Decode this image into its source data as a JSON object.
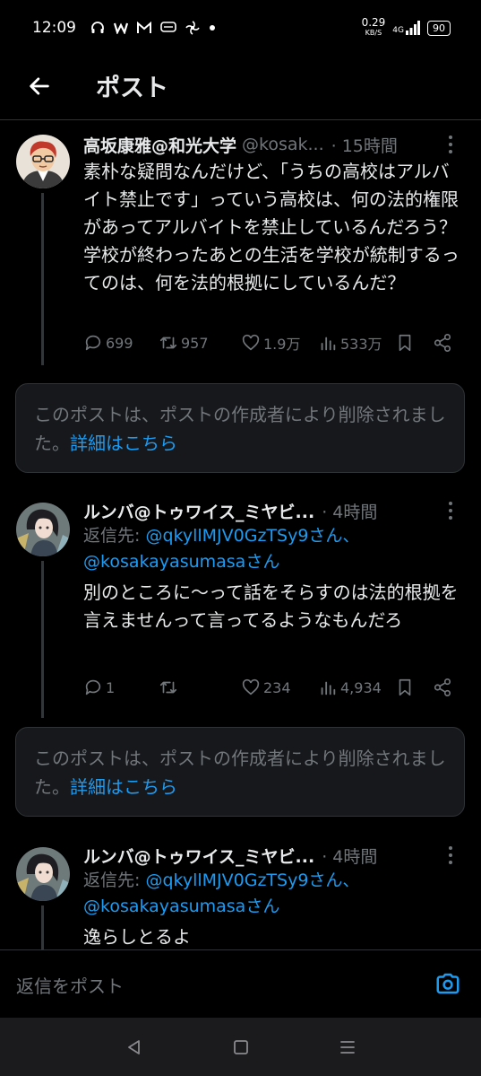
{
  "status": {
    "time": "12:09",
    "speed_value": "0.29",
    "speed_unit": "KB/S",
    "network": "4G",
    "battery": "90",
    "icons": [
      "headphones-icon",
      "w-app-icon",
      "gmail-icon",
      "chat-icon",
      "pinwheel-icon",
      "dot-icon"
    ]
  },
  "header": {
    "title": "ポスト",
    "back_icon": "arrow-left-icon"
  },
  "posts": [
    {
      "name": "高坂康雅@和光大学",
      "handle": "@kosak...",
      "time": "· 15時間",
      "text": "素朴な疑問なんだけど、「うちの高校はアルバイト禁止です」っていう高校は、何の法的権限があってアルバイトを禁止しているんだろう？　学校が終わったあとの生活を学校が統制するってのは、何を法的根拠にしているんだ？",
      "replies": "699",
      "reposts": "957",
      "likes": "1.9万",
      "views": "533万"
    },
    {
      "name": "ルンバ@トゥワイス_ミヤビ...",
      "time": "· 4時間",
      "reply_prefix": "返信先: ",
      "mention1": "@qkyllMJV0GzTSy9さん、",
      "mention2": "@kosakayasumasaさん",
      "text": "別のところに〜って話をそらすのは法的根拠を言えませんって言ってるようなもんだろ",
      "replies": "1",
      "reposts": "",
      "likes": "234",
      "views": "4,934"
    },
    {
      "name": "ルンバ@トゥワイス_ミヤビ...",
      "time": "· 4時間",
      "reply_prefix": "返信先: ",
      "mention1": "@qkyllMJV0GzTSy9さん、",
      "mention2": "@kosakayasumasaさん",
      "text": "逸らしとるよ"
    }
  ],
  "deleted": {
    "text": "このポストは、ポストの作成者により削除されました。",
    "link": "詳細はこちら"
  },
  "reply_bar": {
    "placeholder": "返信をポスト"
  },
  "colors": {
    "accent": "#1d9bf0",
    "muted": "#71767b",
    "background": "#000000"
  }
}
